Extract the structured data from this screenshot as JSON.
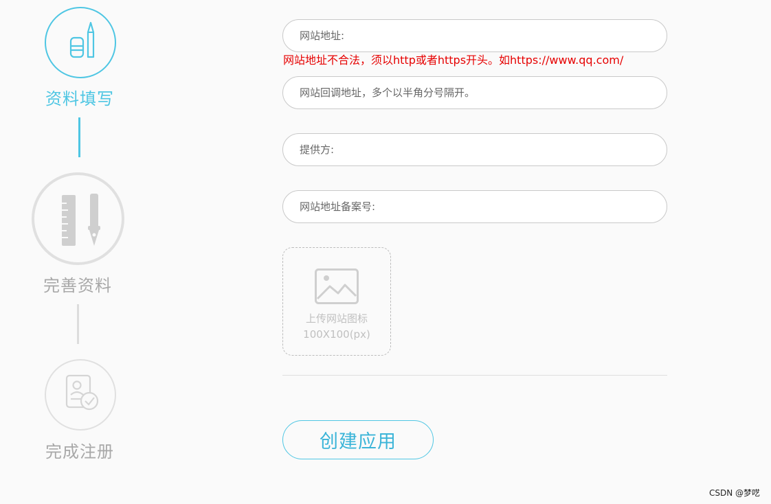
{
  "steps": [
    {
      "label": "资料填写",
      "icon": "pen-eraser-icon",
      "state": "active"
    },
    {
      "label": "完善资料",
      "icon": "ruler-pen-icon",
      "state": "inactive"
    },
    {
      "label": "完成注册",
      "icon": "certificate-check-icon",
      "state": "inactive"
    }
  ],
  "form": {
    "website_placeholder": "网站地址:",
    "website_error": "网站地址不合法，须以http或者https开头。如https://www.qq.com/",
    "callback_placeholder": "网站回调地址，多个以半角分号隔开。",
    "provider_placeholder": "提供方:",
    "icp_placeholder": "网站地址备案号:",
    "upload_label": "上传网站图标",
    "upload_size": "100X100(px)",
    "submit_label": "创建应用"
  },
  "watermark": "CSDN @梦呓",
  "colors": {
    "accent": "#4ec6e3",
    "inactive": "#cfcfcf",
    "error": "#e60000"
  }
}
